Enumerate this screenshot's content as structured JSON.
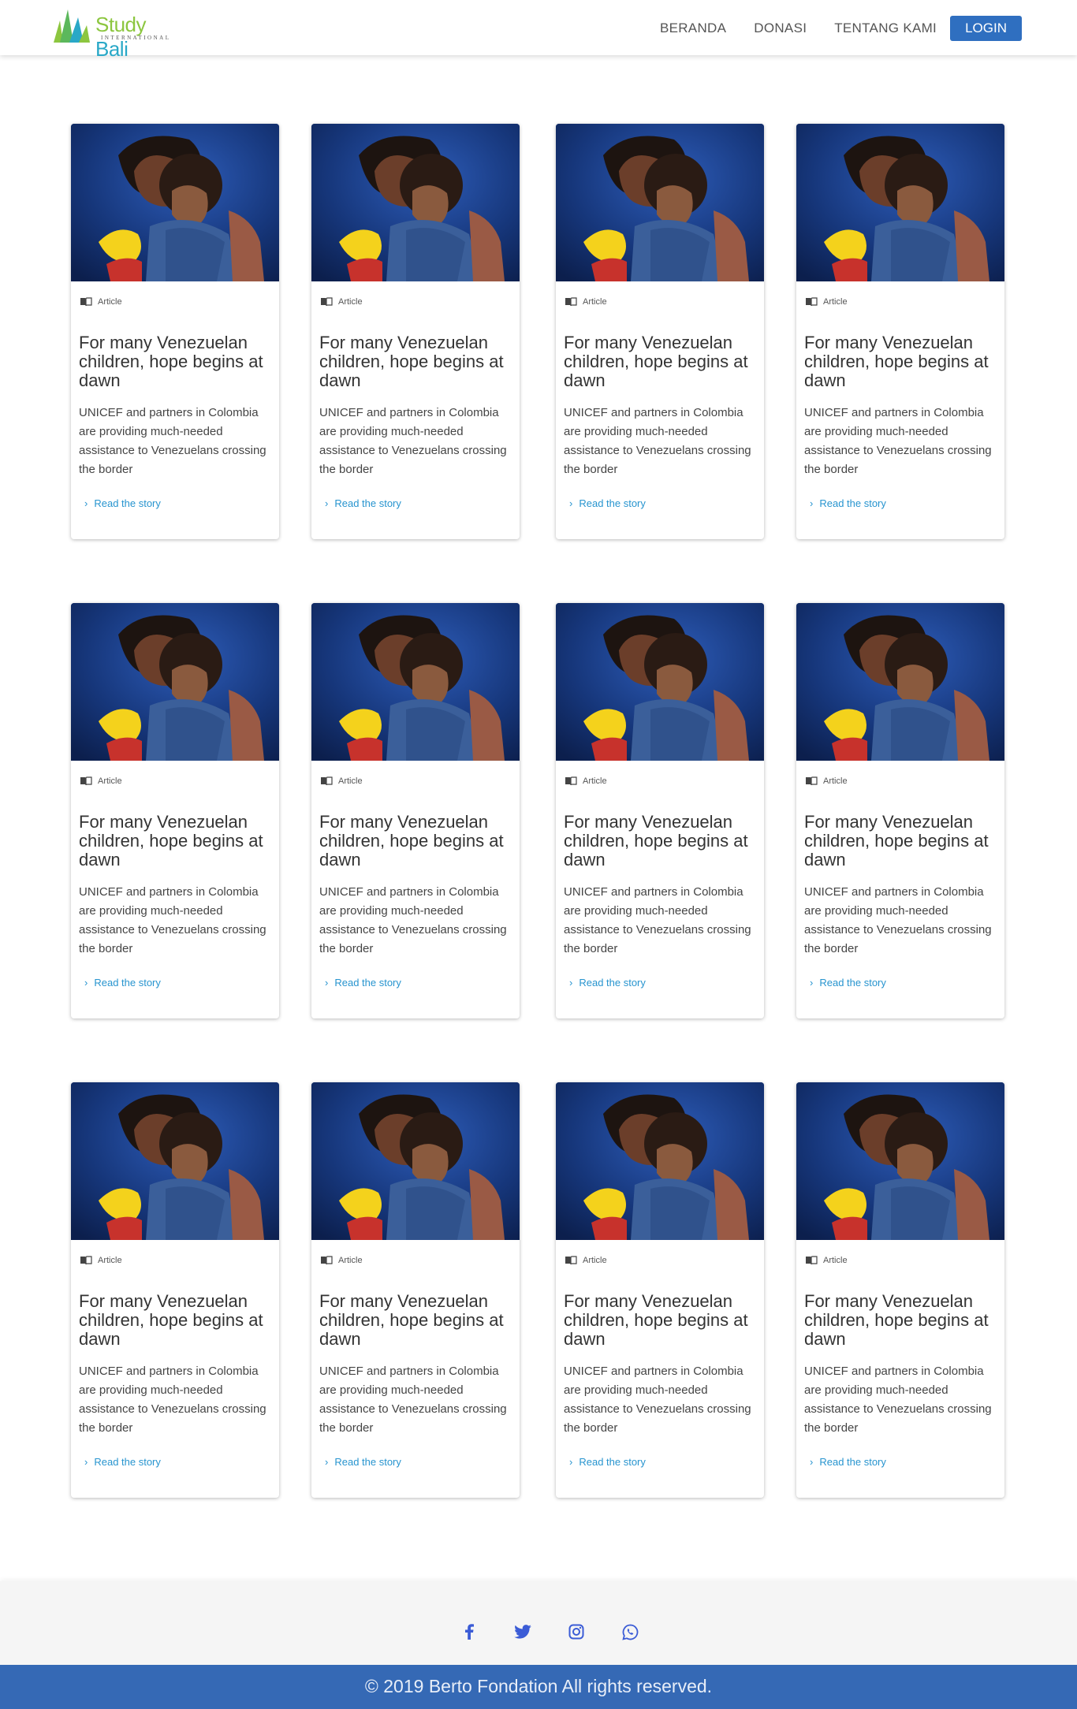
{
  "brand": {
    "name_part1": "Study",
    "name_part2": "Bali",
    "subtitle": "INTERNATIONAL"
  },
  "nav": {
    "links": [
      "BERANDA",
      "DONASI",
      "TENTANG KAMI"
    ],
    "login": "LOGIN"
  },
  "card_template": {
    "type": "Article",
    "title": "For many Venezuelan children, hope begins at dawn",
    "description": "UNICEF and partners in Colombia are providing much-needed assistance to Venezuelans crossing the border",
    "link": "Read the story"
  },
  "cards": [
    {
      "type": "Article",
      "title": "For many Venezuelan children, hope begins at dawn",
      "description": "UNICEF and partners in Colombia are providing much-needed assistance to Venezuelans crossing the border",
      "link": "Read the story"
    },
    {
      "type": "Article",
      "title": "For many Venezuelan children, hope begins at dawn",
      "description": "UNICEF and partners in Colombia are providing much-needed assistance to Venezuelans crossing the border",
      "link": "Read the story"
    },
    {
      "type": "Article",
      "title": "For many Venezuelan children, hope begins at dawn",
      "description": "UNICEF and partners in Colombia are providing much-needed assistance to Venezuelans crossing the border",
      "link": "Read the story"
    },
    {
      "type": "Article",
      "title": "For many Venezuelan children, hope begins at dawn",
      "description": "UNICEF and partners in Colombia are providing much-needed assistance to Venezuelans crossing the border",
      "link": "Read the story"
    },
    {
      "type": "Article",
      "title": "For many Venezuelan children, hope begins at dawn",
      "description": "UNICEF and partners in Colombia are providing much-needed assistance to Venezuelans crossing the border",
      "link": "Read the story"
    },
    {
      "type": "Article",
      "title": "For many Venezuelan children, hope begins at dawn",
      "description": "UNICEF and partners in Colombia are providing much-needed assistance to Venezuelans crossing the border",
      "link": "Read the story"
    },
    {
      "type": "Article",
      "title": "For many Venezuelan children, hope begins at dawn",
      "description": "UNICEF and partners in Colombia are providing much-needed assistance to Venezuelans crossing the border",
      "link": "Read the story"
    },
    {
      "type": "Article",
      "title": "For many Venezuelan children, hope begins at dawn",
      "description": "UNICEF and partners in Colombia are providing much-needed assistance to Venezuelans crossing the border",
      "link": "Read the story"
    },
    {
      "type": "Article",
      "title": "For many Venezuelan children, hope begins at dawn",
      "description": "UNICEF and partners in Colombia are providing much-needed assistance to Venezuelans crossing the border",
      "link": "Read the story"
    },
    {
      "type": "Article",
      "title": "For many Venezuelan children, hope begins at dawn",
      "description": "UNICEF and partners in Colombia are providing much-needed assistance to Venezuelans crossing the border",
      "link": "Read the story"
    },
    {
      "type": "Article",
      "title": "For many Venezuelan children, hope begins at dawn",
      "description": "UNICEF and partners in Colombia are providing much-needed assistance to Venezuelans crossing the border",
      "link": "Read the story"
    },
    {
      "type": "Article",
      "title": "For many Venezuelan children, hope begins at dawn",
      "description": "UNICEF and partners in Colombia are providing much-needed assistance to Venezuelans crossing the border",
      "link": "Read the story"
    }
  ],
  "footer": {
    "social": [
      "facebook-icon",
      "twitter-icon",
      "instagram-icon",
      "whatsapp-icon"
    ],
    "social_color": "#3b5cd6",
    "copyright": "© 2019 Berto Fondation All rights reserved."
  },
  "colors": {
    "accent": "#2f6fc0",
    "link": "#2794cf",
    "footer_bar": "#3569b5"
  }
}
